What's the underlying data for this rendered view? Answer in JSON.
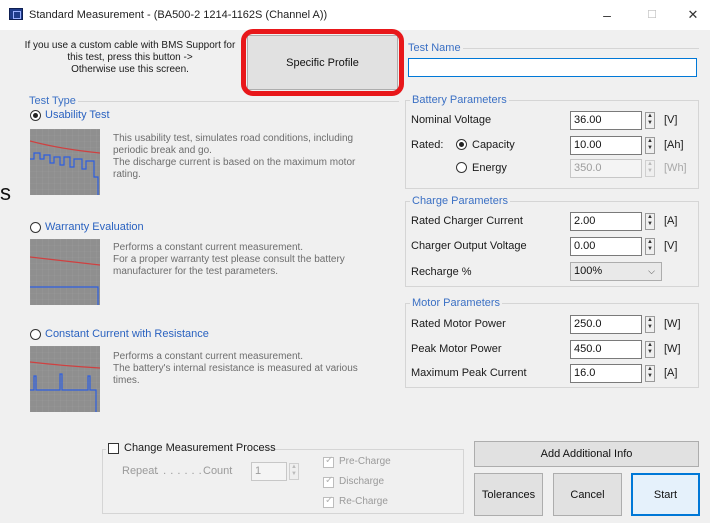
{
  "window": {
    "title": "Standard Measurement - (BA500-2 1214-1162S (Channel A))",
    "minimize": "–",
    "maximize": "☐",
    "close": "✕"
  },
  "header": {
    "info_line1": "If you use a custom cable with BMS Support for",
    "info_line2": "this test, press this button ->",
    "info_line3": "Otherwise use this screen.",
    "specific_profile": "Specific Profile",
    "highlight_color": "#e8171a"
  },
  "test_type": {
    "legend": "Test Type",
    "usability": {
      "label": "Usability Test",
      "selected": true,
      "desc1": "This usability test, simulates road conditions, including",
      "desc2": "periodic break and go.",
      "desc3": "The discharge current is based on the maximum motor",
      "desc4": "rating."
    },
    "warranty": {
      "label": "Warranty Evaluation",
      "selected": false,
      "desc1": "Performs a constant current measurement.",
      "desc2": "For a proper warranty test please consult the battery",
      "desc3": "manufacturer for the test parameters."
    },
    "constant": {
      "label": "Constant Current with Resistance",
      "selected": false,
      "desc1": "Performs a constant current measurement.",
      "desc2": "The battery's internal resistance is measured at various",
      "desc3": "times."
    }
  },
  "test_name": {
    "legend": "Test Name",
    "value": ""
  },
  "battery": {
    "legend": "Battery Parameters",
    "nominal_voltage_label": "Nominal Voltage",
    "nominal_voltage": "36.00",
    "nominal_voltage_unit": "[V]",
    "rated_label": "Rated:",
    "capacity_label": "Capacity",
    "capacity": "10.00",
    "capacity_unit": "[Ah]",
    "energy_label": "Energy",
    "energy": "350.0",
    "energy_unit": "[Wh]"
  },
  "charge": {
    "legend": "Charge Parameters",
    "rated_current_label": "Rated Charger Current",
    "rated_current": "2.00",
    "rated_current_unit": "[A]",
    "output_voltage_label": "Charger Output Voltage",
    "output_voltage": "0.00",
    "output_voltage_unit": "[V]",
    "recharge_label": "Recharge %",
    "recharge": "100%"
  },
  "motor": {
    "legend": "Motor Parameters",
    "rated_power_label": "Rated Motor Power",
    "rated_power": "250.0",
    "rated_power_unit": "[W]",
    "peak_power_label": "Peak Motor Power",
    "peak_power": "450.0",
    "peak_power_unit": "[W]",
    "peak_current_label": "Maximum Peak Current",
    "peak_current": "16.0",
    "peak_current_unit": "[A]"
  },
  "process": {
    "change_label": "Change Measurement Process",
    "repeat_label": "Repeat",
    "dots": ". . . . . . .",
    "count_label": "Count",
    "count": "1",
    "precharge": "Pre-Charge",
    "discharge": "Discharge",
    "recharge": "Re-Charge"
  },
  "buttons": {
    "add_info": "Add Additional Info",
    "tolerances": "Tolerances",
    "cancel": "Cancel",
    "start": "Start"
  },
  "left_margin_glyph": "s"
}
